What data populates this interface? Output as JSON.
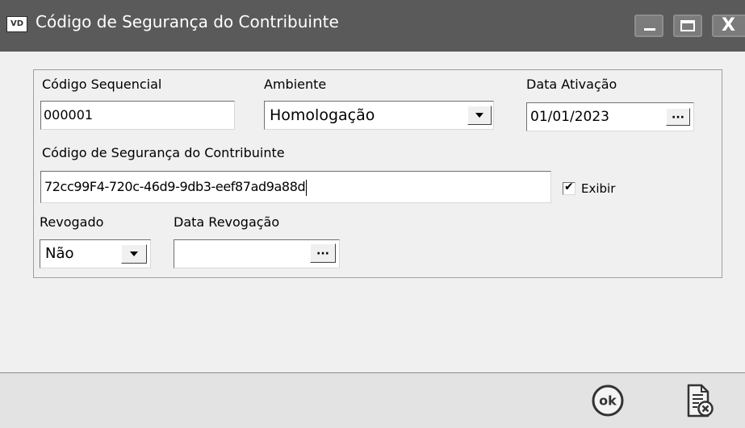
{
  "window": {
    "icon_text": "VD",
    "title": "Código de Segurança do Contribuinte",
    "close_glyph": "X"
  },
  "form": {
    "codigo_sequencial": {
      "label": "Código Sequencial",
      "value": "000001"
    },
    "ambiente": {
      "label": "Ambiente",
      "selected": "Homologação"
    },
    "data_ativacao": {
      "label": "Data Ativação",
      "value": "01/01/2023",
      "button_label": "···"
    },
    "csc": {
      "label": "Código de Segurança do Contribuinte",
      "value": "72cc99F4-720c-46d9-9db3-eef87ad9a88d"
    },
    "exibir": {
      "label": "Exibir",
      "checked": true,
      "mark": "✔"
    },
    "revogado": {
      "label": "Revogado",
      "selected": "Não"
    },
    "data_revogacao": {
      "label": "Data Revogação",
      "value": "",
      "button_label": "···"
    }
  },
  "footer": {
    "ok_label": "ok"
  },
  "colors": {
    "titlebar": "#5a5a5a",
    "window_bg": "#f0f0f0",
    "footer_bg": "#e3e3e3"
  }
}
